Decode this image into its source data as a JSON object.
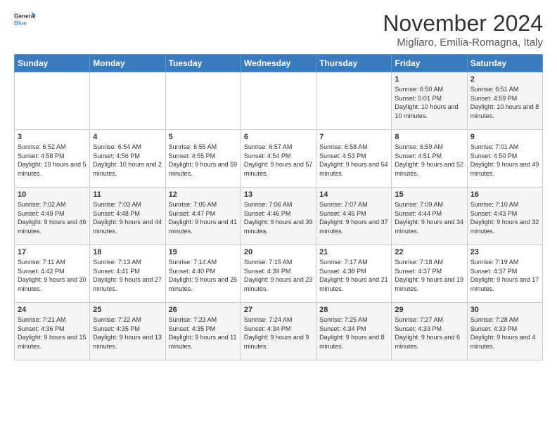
{
  "logo": {
    "line1": "General",
    "line2": "Blue"
  },
  "title": "November 2024",
  "location": "Migliaro, Emilia-Romagna, Italy",
  "headers": [
    "Sunday",
    "Monday",
    "Tuesday",
    "Wednesday",
    "Thursday",
    "Friday",
    "Saturday"
  ],
  "weeks": [
    [
      {
        "day": "",
        "info": ""
      },
      {
        "day": "",
        "info": ""
      },
      {
        "day": "",
        "info": ""
      },
      {
        "day": "",
        "info": ""
      },
      {
        "day": "",
        "info": ""
      },
      {
        "day": "1",
        "info": "Sunrise: 6:50 AM\nSunset: 5:01 PM\nDaylight: 10 hours and 10 minutes."
      },
      {
        "day": "2",
        "info": "Sunrise: 6:51 AM\nSunset: 4:59 PM\nDaylight: 10 hours and 8 minutes."
      }
    ],
    [
      {
        "day": "3",
        "info": "Sunrise: 6:52 AM\nSunset: 4:58 PM\nDaylight: 10 hours and 5 minutes."
      },
      {
        "day": "4",
        "info": "Sunrise: 6:54 AM\nSunset: 4:56 PM\nDaylight: 10 hours and 2 minutes."
      },
      {
        "day": "5",
        "info": "Sunrise: 6:55 AM\nSunset: 4:55 PM\nDaylight: 9 hours and 59 minutes."
      },
      {
        "day": "6",
        "info": "Sunrise: 6:57 AM\nSunset: 4:54 PM\nDaylight: 9 hours and 57 minutes."
      },
      {
        "day": "7",
        "info": "Sunrise: 6:58 AM\nSunset: 4:53 PM\nDaylight: 9 hours and 54 minutes."
      },
      {
        "day": "8",
        "info": "Sunrise: 6:59 AM\nSunset: 4:51 PM\nDaylight: 9 hours and 52 minutes."
      },
      {
        "day": "9",
        "info": "Sunrise: 7:01 AM\nSunset: 4:50 PM\nDaylight: 9 hours and 49 minutes."
      }
    ],
    [
      {
        "day": "10",
        "info": "Sunrise: 7:02 AM\nSunset: 4:49 PM\nDaylight: 9 hours and 46 minutes."
      },
      {
        "day": "11",
        "info": "Sunrise: 7:03 AM\nSunset: 4:48 PM\nDaylight: 9 hours and 44 minutes."
      },
      {
        "day": "12",
        "info": "Sunrise: 7:05 AM\nSunset: 4:47 PM\nDaylight: 9 hours and 41 minutes."
      },
      {
        "day": "13",
        "info": "Sunrise: 7:06 AM\nSunset: 4:46 PM\nDaylight: 9 hours and 39 minutes."
      },
      {
        "day": "14",
        "info": "Sunrise: 7:07 AM\nSunset: 4:45 PM\nDaylight: 9 hours and 37 minutes."
      },
      {
        "day": "15",
        "info": "Sunrise: 7:09 AM\nSunset: 4:44 PM\nDaylight: 9 hours and 34 minutes."
      },
      {
        "day": "16",
        "info": "Sunrise: 7:10 AM\nSunset: 4:43 PM\nDaylight: 9 hours and 32 minutes."
      }
    ],
    [
      {
        "day": "17",
        "info": "Sunrise: 7:11 AM\nSunset: 4:42 PM\nDaylight: 9 hours and 30 minutes."
      },
      {
        "day": "18",
        "info": "Sunrise: 7:13 AM\nSunset: 4:41 PM\nDaylight: 9 hours and 27 minutes."
      },
      {
        "day": "19",
        "info": "Sunrise: 7:14 AM\nSunset: 4:40 PM\nDaylight: 9 hours and 25 minutes."
      },
      {
        "day": "20",
        "info": "Sunrise: 7:15 AM\nSunset: 4:39 PM\nDaylight: 9 hours and 23 minutes."
      },
      {
        "day": "21",
        "info": "Sunrise: 7:17 AM\nSunset: 4:38 PM\nDaylight: 9 hours and 21 minutes."
      },
      {
        "day": "22",
        "info": "Sunrise: 7:18 AM\nSunset: 4:37 PM\nDaylight: 9 hours and 19 minutes."
      },
      {
        "day": "23",
        "info": "Sunrise: 7:19 AM\nSunset: 4:37 PM\nDaylight: 9 hours and 17 minutes."
      }
    ],
    [
      {
        "day": "24",
        "info": "Sunrise: 7:21 AM\nSunset: 4:36 PM\nDaylight: 9 hours and 15 minutes."
      },
      {
        "day": "25",
        "info": "Sunrise: 7:22 AM\nSunset: 4:35 PM\nDaylight: 9 hours and 13 minutes."
      },
      {
        "day": "26",
        "info": "Sunrise: 7:23 AM\nSunset: 4:35 PM\nDaylight: 9 hours and 11 minutes."
      },
      {
        "day": "27",
        "info": "Sunrise: 7:24 AM\nSunset: 4:34 PM\nDaylight: 9 hours and 9 minutes."
      },
      {
        "day": "28",
        "info": "Sunrise: 7:25 AM\nSunset: 4:34 PM\nDaylight: 9 hours and 8 minutes."
      },
      {
        "day": "29",
        "info": "Sunrise: 7:27 AM\nSunset: 4:33 PM\nDaylight: 9 hours and 6 minutes."
      },
      {
        "day": "30",
        "info": "Sunrise: 7:28 AM\nSunset: 4:33 PM\nDaylight: 9 hours and 4 minutes."
      }
    ]
  ]
}
